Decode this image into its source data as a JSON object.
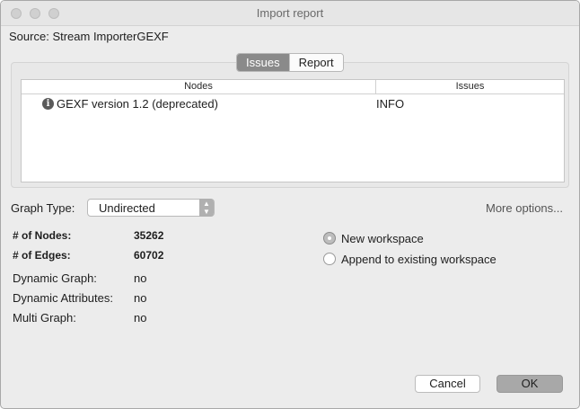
{
  "window": {
    "title": "Import report"
  },
  "source": {
    "label": "Source:",
    "value": "Stream ImporterGEXF"
  },
  "tabs": [
    {
      "label": "Issues",
      "selected": true
    },
    {
      "label": "Report",
      "selected": false
    }
  ],
  "issues_table": {
    "columns": [
      "Nodes",
      "Issues"
    ],
    "rows": [
      {
        "icon": "info-icon",
        "node": "GEXF version 1.2 (deprecated)",
        "issue": "INFO"
      }
    ]
  },
  "graph_type": {
    "label": "Graph Type:",
    "value": "Undirected"
  },
  "more_options": "More options...",
  "stats": {
    "nodes_label": "# of Nodes:",
    "nodes_value": "35262",
    "edges_label": "# of Edges:",
    "edges_value": "60702",
    "dynamic_graph_label": "Dynamic Graph:",
    "dynamic_graph_value": "no",
    "dynamic_attributes_label": "Dynamic Attributes:",
    "dynamic_attributes_value": "no",
    "multi_graph_label": "Multi Graph:",
    "multi_graph_value": "no"
  },
  "workspace_options": [
    {
      "label": "New workspace",
      "selected": true
    },
    {
      "label": "Append to existing workspace",
      "selected": false
    }
  ],
  "buttons": {
    "cancel": "Cancel",
    "ok": "OK"
  },
  "colors": {
    "selected_tab": "#8a8a8a",
    "dialog_background": "#ececec"
  }
}
